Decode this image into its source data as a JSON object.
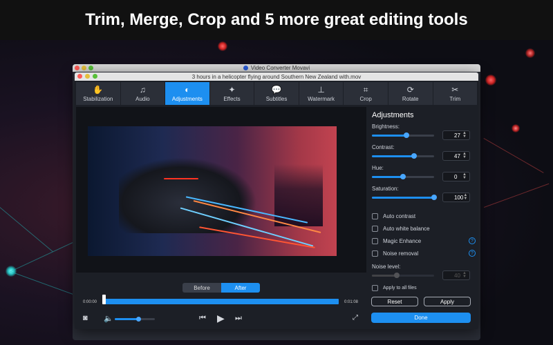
{
  "headline": "Trim, Merge, Crop and 5 more great editing tools",
  "outer_window": {
    "title": "Video Converter Movavi"
  },
  "inner_window": {
    "title": "3 hours in a helicopter flying around Southern New Zealand with.mov"
  },
  "toolbar": {
    "items": [
      {
        "label": "Stabilization",
        "icon": "stabilization-icon",
        "glyph": "✋",
        "active": false
      },
      {
        "label": "Audio",
        "icon": "music-note-icon",
        "glyph": "♫",
        "active": false
      },
      {
        "label": "Adjustments",
        "icon": "adjustments-icon",
        "glyph": "◐",
        "active": true
      },
      {
        "label": "Effects",
        "icon": "magic-wand-icon",
        "glyph": "✦",
        "active": false
      },
      {
        "label": "Subtitles",
        "icon": "subtitles-icon",
        "glyph": "💬",
        "active": false
      },
      {
        "label": "Watermark",
        "icon": "stamp-icon",
        "glyph": "⊥",
        "active": false
      },
      {
        "label": "Crop",
        "icon": "crop-icon",
        "glyph": "⌗",
        "active": false
      },
      {
        "label": "Rotate",
        "icon": "rotate-icon",
        "glyph": "⟳",
        "active": false
      },
      {
        "label": "Trim",
        "icon": "scissors-icon",
        "glyph": "✂",
        "active": false
      }
    ]
  },
  "adjustments": {
    "title": "Adjustments",
    "brightness": {
      "label": "Brightness:",
      "value": "27",
      "level": 0.55
    },
    "contrast": {
      "label": "Contrast:",
      "value": "47",
      "level": 0.68
    },
    "hue": {
      "label": "Hue:",
      "value": "0",
      "level": 0.5
    },
    "saturation": {
      "label": "Saturation:",
      "value": "100",
      "level": 1.0
    },
    "auto_contrast": "Auto contrast",
    "auto_white_balance": "Auto white balance",
    "magic_enhance": "Magic Enhance",
    "noise_removal": "Noise removal",
    "noise_level": {
      "label": "Noise level:",
      "value": "40",
      "level": 0.4
    }
  },
  "player": {
    "before_label": "Before",
    "after_label": "After",
    "time_start": "0:00:00",
    "time_end": "0:01:08",
    "volume_level": 0.6
  },
  "actions": {
    "apply_all": "Apply to all files",
    "reset": "Reset",
    "apply": "Apply",
    "done": "Done"
  },
  "colors": {
    "accent": "#1d8ff0"
  }
}
